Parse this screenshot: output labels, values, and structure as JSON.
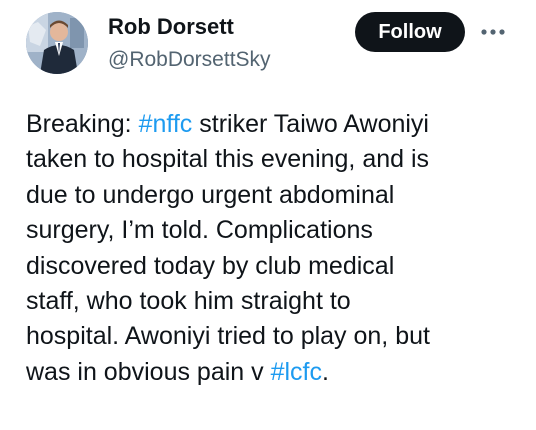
{
  "author": {
    "display_name": "Rob Dorsett",
    "handle": "@RobDorsettSky"
  },
  "actions": {
    "follow_label": "Follow",
    "more_icon": "more-horizontal-icon"
  },
  "tweet": {
    "lines": [
      {
        "pre": "Breaking: ",
        "tag": "#nffc",
        "post": " striker Taiwo Awoniyi"
      },
      {
        "text": "taken to hospital this evening, and is"
      },
      {
        "text": "due to undergo urgent abdominal"
      },
      {
        "text": "surgery, I’m told. Complications"
      },
      {
        "text": "discovered today by club medical"
      },
      {
        "text": "staff, who took him straight to"
      },
      {
        "text": "hospital. Awoniyi tried to play on,  but"
      },
      {
        "pre": "was in obvious pain v ",
        "tag": "#lcfc",
        "post": "."
      }
    ]
  },
  "colors": {
    "text": "#0f1419",
    "secondary": "#536471",
    "link": "#1d9bf0",
    "button_bg": "#0f1419",
    "button_text": "#ffffff"
  }
}
